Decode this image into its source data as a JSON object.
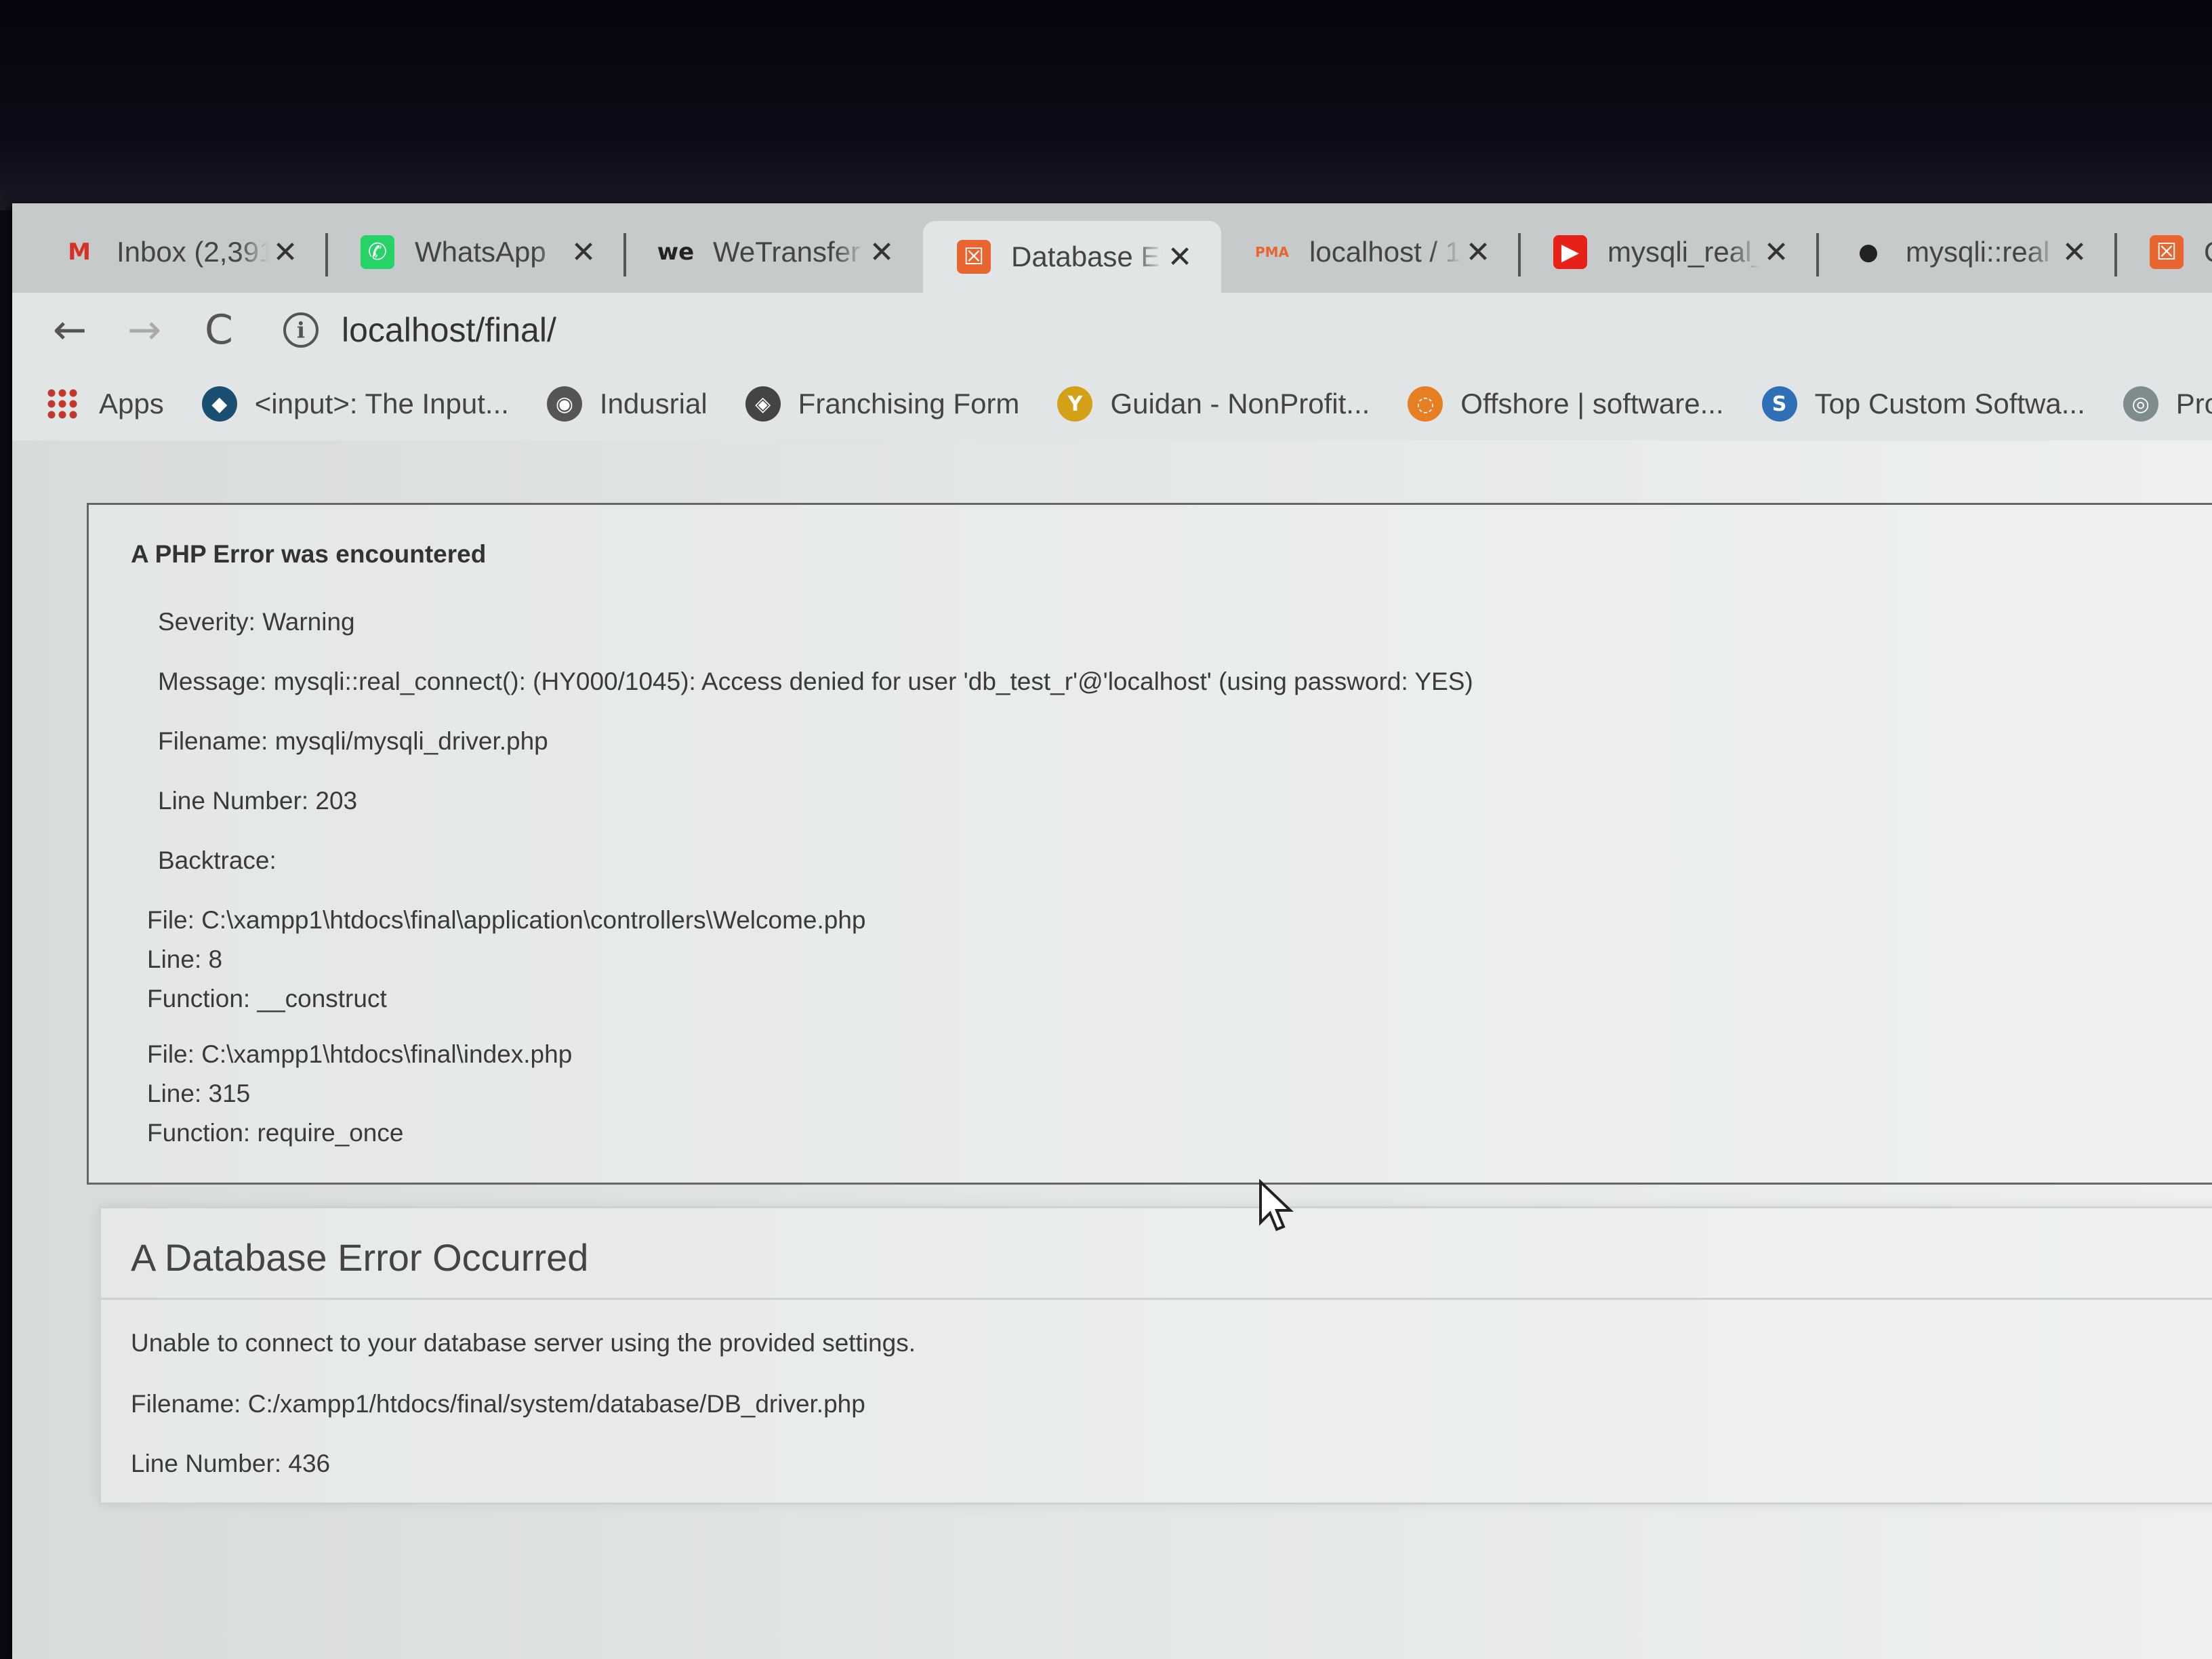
{
  "tabs": [
    {
      "title": "Inbox (2,391",
      "icon": "gmail-icon",
      "glyph": "M",
      "color": "#d93025",
      "bg": "transparent"
    },
    {
      "title": "WhatsApp",
      "icon": "whatsapp-icon",
      "glyph": "✆",
      "color": "#ffffff",
      "bg": "#25d366"
    },
    {
      "title": "WeTransfer",
      "icon": "wetransfer-icon",
      "glyph": "we",
      "color": "#222222",
      "bg": "transparent"
    },
    {
      "title": "Database Er",
      "icon": "codeigniter-icon",
      "glyph": "☒",
      "color": "#ffffff",
      "bg": "#e8652f",
      "active": true
    },
    {
      "title": "localhost / 1",
      "icon": "phpmyadmin-icon",
      "glyph": "PMA",
      "color": "#e8652f",
      "bg": "transparent"
    },
    {
      "title": "mysqli_real_",
      "icon": "youtube-icon",
      "glyph": "▶",
      "color": "#ffffff",
      "bg": "#e62117"
    },
    {
      "title": "mysqli::real",
      "icon": "github-icon",
      "glyph": "●",
      "color": "#222222",
      "bg": "transparent"
    },
    {
      "title": "C",
      "icon": "codeigniter-icon",
      "glyph": "☒",
      "color": "#ffffff",
      "bg": "#e8652f"
    }
  ],
  "toolbar": {
    "back": "←",
    "forward": "→",
    "reload": "C",
    "info": "i",
    "url": "localhost/final/"
  },
  "bookmarks": [
    {
      "label": "Apps",
      "icon": "apps-grid-icon"
    },
    {
      "label": "<input>: The Input...",
      "icon": "mdn-icon",
      "glyph": "◆",
      "bg": "#1b4f72"
    },
    {
      "label": "Indusrial",
      "icon": "globe-icon",
      "glyph": "◉",
      "bg": "#555555"
    },
    {
      "label": "Franchising Form",
      "icon": "form-icon",
      "glyph": "◈",
      "bg": "#444444"
    },
    {
      "label": "Guidan - NonProfit...",
      "icon": "guidan-icon",
      "glyph": "Y",
      "bg": "#d4a017"
    },
    {
      "label": "Offshore | software...",
      "icon": "offshore-icon",
      "glyph": "◌",
      "bg": "#e67e22"
    },
    {
      "label": "Top Custom Softwa...",
      "icon": "software-icon",
      "glyph": "S",
      "bg": "#2e6fb5"
    },
    {
      "label": "Produ",
      "icon": "product-icon",
      "glyph": "◎",
      "bg": "#7f8c8d"
    }
  ],
  "php_error": {
    "heading": "A PHP Error was encountered",
    "severity": "Severity: Warning",
    "message": "Message: mysqli::real_connect(): (HY000/1045): Access denied for user 'db_test_r'@'localhost' (using password: YES)",
    "filename": "Filename: mysqli/mysqli_driver.php",
    "line_number": "Line Number: 203",
    "backtrace_label": "Backtrace:",
    "backtrace": [
      {
        "file": "File: C:\\xampp1\\htdocs\\final\\application\\controllers\\Welcome.php",
        "line": "Line: 8",
        "function": "Function: __construct"
      },
      {
        "file": "File: C:\\xampp1\\htdocs\\final\\index.php",
        "line": "Line: 315",
        "function": "Function: require_once"
      }
    ]
  },
  "db_error": {
    "heading": "A Database Error Occurred",
    "message": "Unable to connect to your database server using the provided settings.",
    "filename": "Filename: C:/xampp1/htdocs/final/system/database/DB_driver.php",
    "line_number": "Line Number: 436"
  }
}
